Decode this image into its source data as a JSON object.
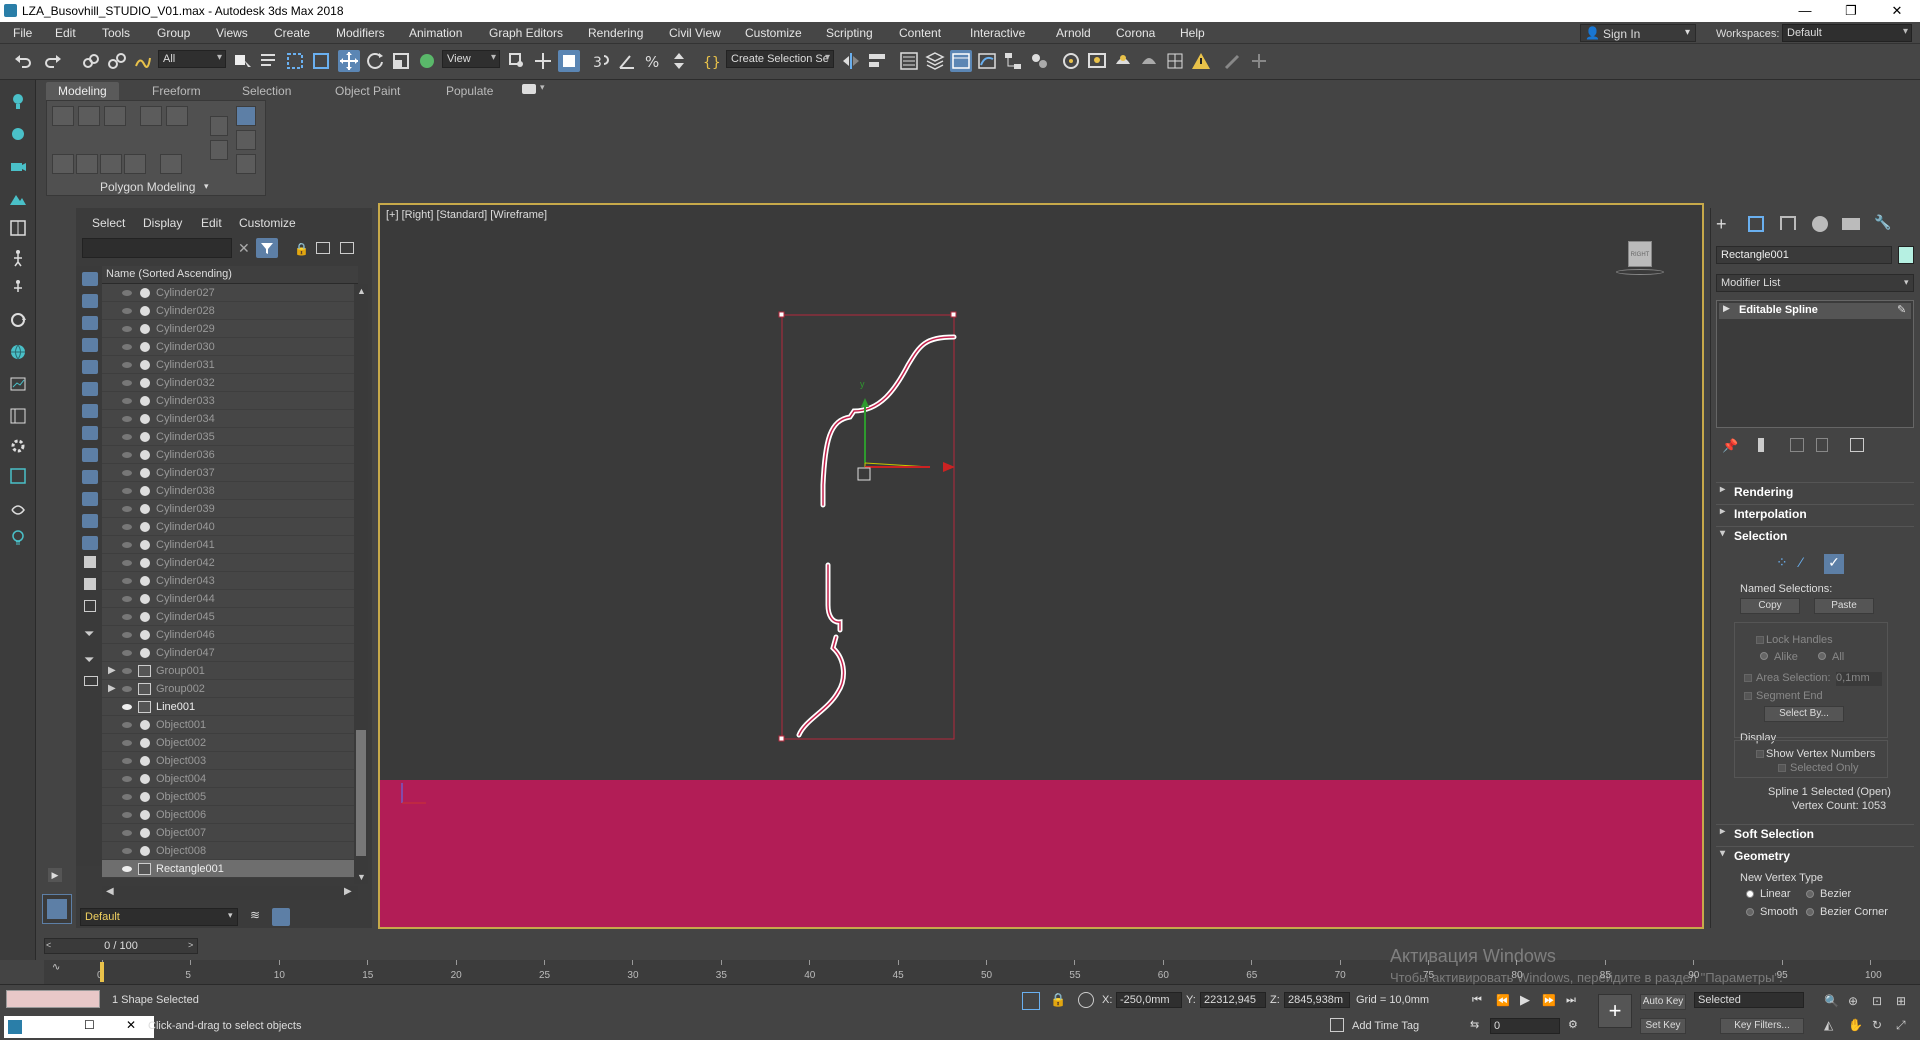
{
  "window": {
    "title": "LZA_Busovhill_STUDIO_V01.max - Autodesk 3ds Max 2018",
    "min": "—",
    "max": "❐",
    "close": "✕"
  },
  "menubar": [
    "File",
    "Edit",
    "Tools",
    "Group",
    "Views",
    "Create",
    "Modifiers",
    "Animation",
    "Graph Editors",
    "Rendering",
    "Civil View",
    "Customize",
    "Scripting",
    "Content",
    "Interactive",
    "Arnold",
    "Corona",
    "Help"
  ],
  "account": {
    "signin": "Sign In",
    "workspaces_label": "Workspaces:",
    "workspace": "Default"
  },
  "toolbar": {
    "filter": "All",
    "view": "View",
    "selection_set": "Create Selection Se"
  },
  "ribbon": {
    "tabs": [
      "Modeling",
      "Freeform",
      "Selection",
      "Object Paint",
      "Populate"
    ],
    "panel_title": "Polygon Modeling"
  },
  "explorer": {
    "menu": [
      "Select",
      "Display",
      "Edit",
      "Customize"
    ],
    "column_header": "Name (Sorted Ascending)",
    "items": [
      {
        "name": "Cylinder027",
        "kind": "obj"
      },
      {
        "name": "Cylinder028",
        "kind": "obj"
      },
      {
        "name": "Cylinder029",
        "kind": "obj"
      },
      {
        "name": "Cylinder030",
        "kind": "obj"
      },
      {
        "name": "Cylinder031",
        "kind": "obj"
      },
      {
        "name": "Cylinder032",
        "kind": "obj"
      },
      {
        "name": "Cylinder033",
        "kind": "obj"
      },
      {
        "name": "Cylinder034",
        "kind": "obj"
      },
      {
        "name": "Cylinder035",
        "kind": "obj"
      },
      {
        "name": "Cylinder036",
        "kind": "obj"
      },
      {
        "name": "Cylinder037",
        "kind": "obj"
      },
      {
        "name": "Cylinder038",
        "kind": "obj"
      },
      {
        "name": "Cylinder039",
        "kind": "obj"
      },
      {
        "name": "Cylinder040",
        "kind": "obj"
      },
      {
        "name": "Cylinder041",
        "kind": "obj"
      },
      {
        "name": "Cylinder042",
        "kind": "obj"
      },
      {
        "name": "Cylinder043",
        "kind": "obj"
      },
      {
        "name": "Cylinder044",
        "kind": "obj"
      },
      {
        "name": "Cylinder045",
        "kind": "obj"
      },
      {
        "name": "Cylinder046",
        "kind": "obj"
      },
      {
        "name": "Cylinder047",
        "kind": "obj"
      },
      {
        "name": "Group001",
        "kind": "group"
      },
      {
        "name": "Group002",
        "kind": "group"
      },
      {
        "name": "Line001",
        "kind": "visible"
      },
      {
        "name": "Object001",
        "kind": "obj"
      },
      {
        "name": "Object002",
        "kind": "obj"
      },
      {
        "name": "Object003",
        "kind": "obj"
      },
      {
        "name": "Object004",
        "kind": "obj"
      },
      {
        "name": "Object005",
        "kind": "obj"
      },
      {
        "name": "Object006",
        "kind": "obj"
      },
      {
        "name": "Object007",
        "kind": "obj"
      },
      {
        "name": "Object008",
        "kind": "obj"
      },
      {
        "name": "Rectangle001",
        "kind": "selected"
      }
    ],
    "layer": "Default"
  },
  "viewport": {
    "label": "[+] [Right] [Standard] [Wireframe]",
    "viewcube": "RIGHT",
    "axis_y": "y"
  },
  "command_panel": {
    "object_name": "Rectangle001",
    "object_color": "#b6f0e2",
    "modifier_list": "Modifier List",
    "stack_item": "Editable Spline",
    "rollouts": {
      "rendering": "Rendering",
      "interpolation": "Interpolation",
      "selection": "Selection",
      "soft_selection": "Soft Selection",
      "geometry": "Geometry"
    },
    "named_selections": "Named Selections:",
    "copy": "Copy",
    "paste": "Paste",
    "lock_handles": "Lock Handles",
    "alike": "Alike",
    "all": "All",
    "area_selection": "Area Selection:",
    "area_value": "0,1mm",
    "segment_end": "Segment End",
    "select_by": "Select By...",
    "display": "Display",
    "show_vertex_numbers": "Show Vertex Numbers",
    "selected_only": "Selected Only",
    "spline_info": "Spline 1 Selected (Open)",
    "vertex_count": "Vertex Count: 1053",
    "new_vertex_type": "New Vertex Type",
    "linear": "Linear",
    "bezier": "Bezier",
    "smooth": "Smooth",
    "bezier_corner": "Bezier Corner"
  },
  "timeline": {
    "slider": "0 / 100",
    "ticks": [
      "0",
      "5",
      "10",
      "15",
      "20",
      "25",
      "30",
      "35",
      "40",
      "45",
      "50",
      "55",
      "60",
      "65",
      "70",
      "75",
      "80",
      "85",
      "90",
      "95",
      "100"
    ]
  },
  "status": {
    "selection": "1 Shape Selected",
    "prompt": "Click-and-drag to select objects",
    "x_label": "X:",
    "x": "-250,0mm",
    "y_label": "Y:",
    "y": "22312,945",
    "z_label": "Z:",
    "z": "2845,938m",
    "grid": "Grid = 10,0mm",
    "add_time_tag": "Add Time Tag",
    "auto_key": "Auto Key",
    "set_key": "Set Key",
    "key_mode": "Selected",
    "key_filters": "Key Filters...",
    "frame": "0"
  },
  "watermark": {
    "line1": "Активация Windows",
    "line2": "Чтобы активировать Windows, перейдите в раздел \"Параметры\"."
  }
}
